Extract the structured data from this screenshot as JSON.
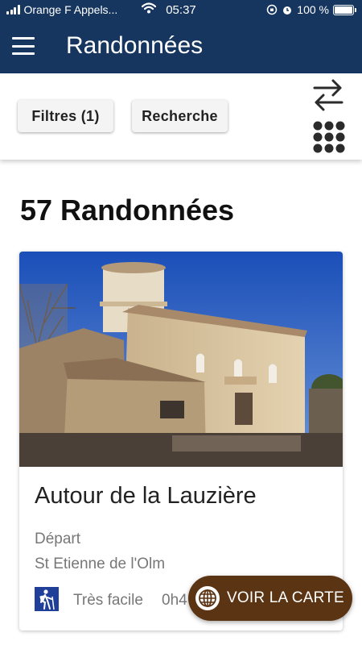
{
  "status_bar": {
    "carrier": "Orange F Appels...",
    "time": "05:37",
    "battery": "100 %",
    "battery_level": 1.0
  },
  "app_bar": {
    "title": "Randonnées",
    "menu_icon": "hamburger-menu-icon"
  },
  "toolbar": {
    "filters_label": "Filtres (1)",
    "search_label": "Recherche",
    "swap_icon": "swap-arrows-icon",
    "grid_icon": "grid-dots-icon"
  },
  "results": {
    "title": "57 Randonnées"
  },
  "hike_card": {
    "title": "Autour de la Lauzière",
    "depart_label": "Départ",
    "depart_value": "St Etienne de l'Olm",
    "difficulty": "Très facile",
    "duration": "0h4",
    "photo": "stone-church-photo",
    "difficulty_icon": "hiker-icon"
  },
  "fab": {
    "label": "VOIR LA CARTE",
    "icon": "globe-icon"
  },
  "colors": {
    "header": "#17365f",
    "fab": "#5b3413",
    "difficulty_icon": "#1f3f99"
  }
}
